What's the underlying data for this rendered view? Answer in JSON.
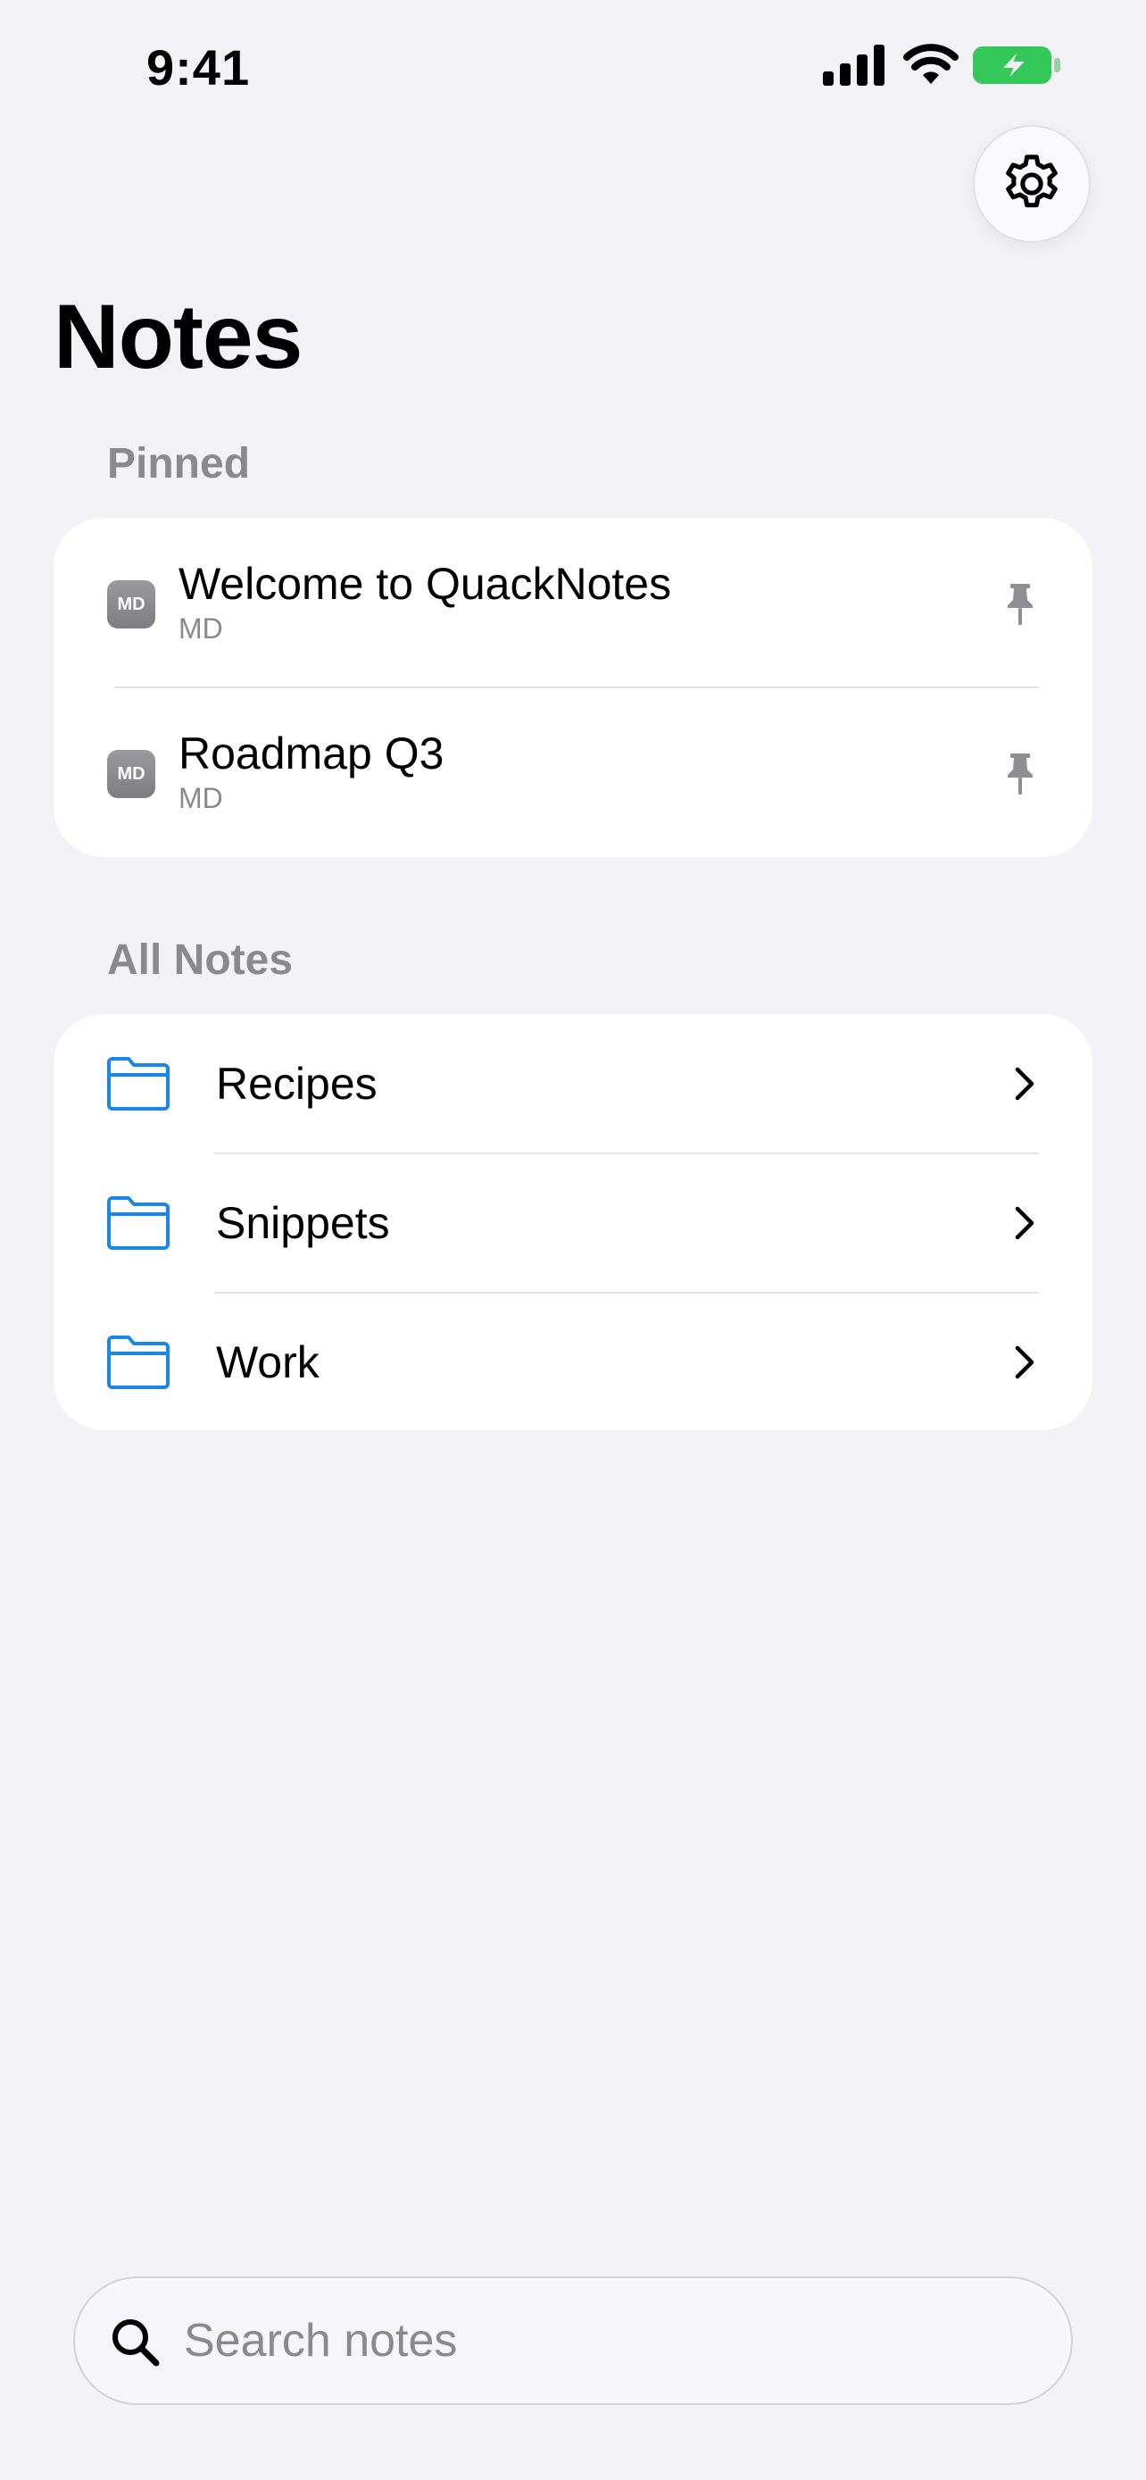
{
  "status_bar": {
    "time": "9:41",
    "icons": [
      "cellular-signal-icon",
      "wifi-icon",
      "battery-charging-icon"
    ],
    "battery_color": "#34c759"
  },
  "header": {
    "settings_icon": "gear-icon",
    "title": "Notes"
  },
  "pinned": {
    "header": "Pinned",
    "items": [
      {
        "title": "Welcome to QuackNotes",
        "badge": "MD",
        "subtitle": "MD",
        "icon": "pin-icon"
      },
      {
        "title": "Roadmap Q3",
        "badge": "MD",
        "subtitle": "MD",
        "icon": "pin-icon"
      }
    ]
  },
  "all_notes": {
    "header": "All Notes",
    "folders": [
      {
        "label": "Recipes",
        "icon": "folder-icon"
      },
      {
        "label": "Snippets",
        "icon": "folder-icon"
      },
      {
        "label": "Work",
        "icon": "folder-icon"
      }
    ],
    "accent_color": "#1a86e8"
  },
  "search": {
    "placeholder": "Search notes",
    "icon": "search-icon"
  }
}
